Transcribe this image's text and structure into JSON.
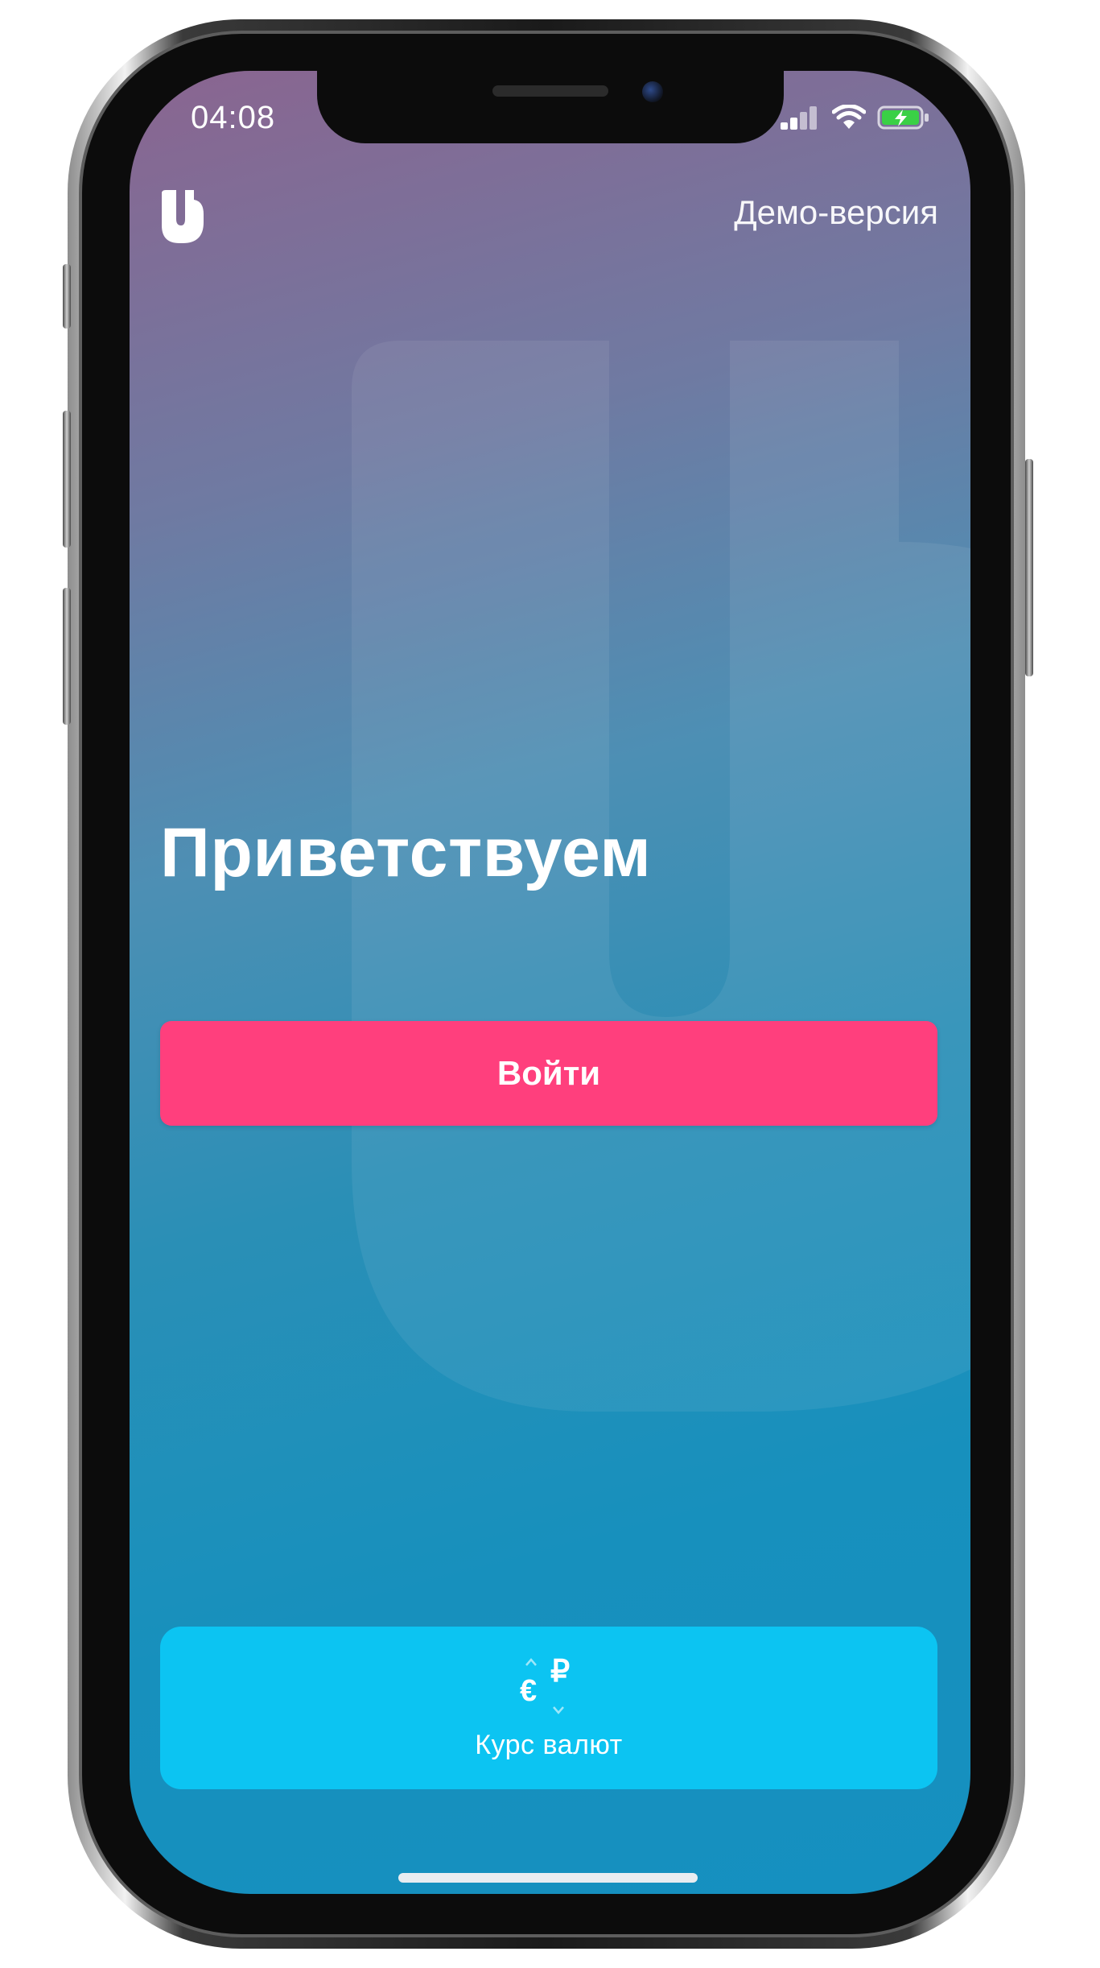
{
  "status_bar": {
    "time": "04:08",
    "icons": [
      "cellular-signal-icon",
      "wifi-icon",
      "battery-charging-icon"
    ],
    "battery_color": "#3ad046"
  },
  "header": {
    "logo_icon": "bank-logo-icon",
    "demo_link": "Демо-версия"
  },
  "main": {
    "welcome_title": "Приветствуем",
    "login_button": "Войти"
  },
  "currency_card": {
    "icon": "currency-exchange-icon",
    "euro_symbol": "€",
    "ruble_symbol": "₽",
    "label": "Курс валют"
  },
  "colors": {
    "accent_pink": "#ff3f7d",
    "card_cyan": "#0cc4f2",
    "gradient_top": "#8a6590",
    "gradient_bottom": "#1590c0"
  }
}
